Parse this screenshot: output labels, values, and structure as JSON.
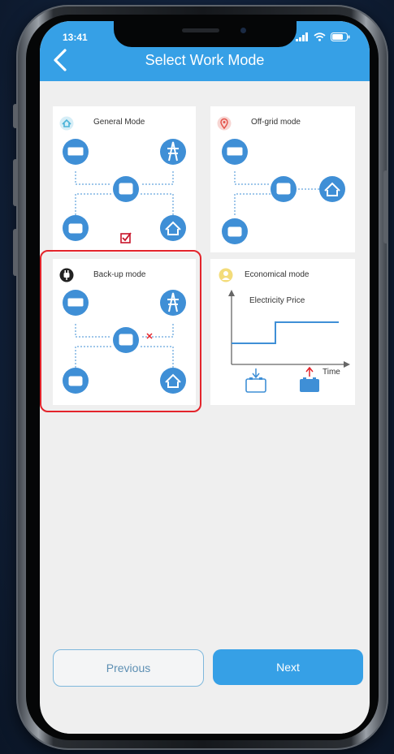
{
  "status_bar": {
    "time": "13:41"
  },
  "header": {
    "title": "Select Work Mode",
    "back_icon": "chevron-left-icon"
  },
  "modes": [
    {
      "title": "General Mode",
      "icon": "home-outline-icon",
      "icon_color": "#4ab3d8"
    },
    {
      "title": "Off-grid mode",
      "icon": "pin-outline-icon",
      "icon_color": "#e5534b"
    },
    {
      "title": "Back-up mode",
      "icon": "plug-icon",
      "icon_color": "#222222",
      "selected": true
    },
    {
      "title": "Economical mode",
      "icon": "coin-icon",
      "icon_color": "#e8c23a"
    }
  ],
  "economical_chart": {
    "title": "Electricity Price",
    "xlabel": "Time"
  },
  "buttons": {
    "previous_label": "Previous",
    "next_label": "Next"
  },
  "colors": {
    "accent": "#36a0e6",
    "selection": "#e3242b",
    "node": "#3f8fd6"
  }
}
